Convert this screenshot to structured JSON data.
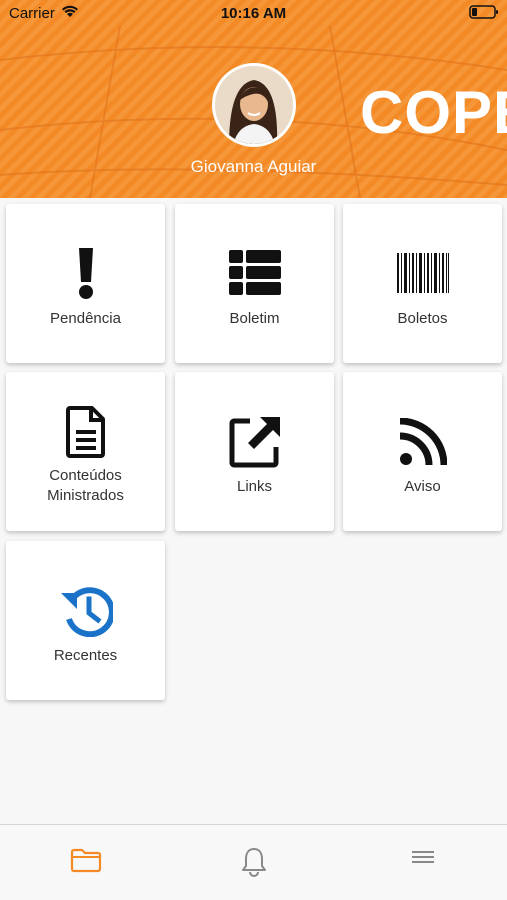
{
  "status_bar": {
    "carrier": "Carrier",
    "time": "10:16 AM"
  },
  "header": {
    "brand": "COPE",
    "user_name": "Giovanna Aguiar"
  },
  "tiles": [
    {
      "label": "Pendência",
      "icon": "exclamation-icon"
    },
    {
      "label": "Boletim",
      "icon": "table-list-icon"
    },
    {
      "label": "Boletos",
      "icon": "barcode-icon"
    },
    {
      "label": "Conteúdos Ministrados",
      "icon": "document-icon"
    },
    {
      "label": "Links",
      "icon": "external-link-icon"
    },
    {
      "label": "Aviso",
      "icon": "rss-icon"
    },
    {
      "label": "Recentes",
      "icon": "history-icon"
    }
  ],
  "tabbar": {
    "items": [
      {
        "icon": "folder-icon",
        "active": true
      },
      {
        "icon": "bell-icon",
        "active": false
      },
      {
        "icon": "menu-icon",
        "active": false
      }
    ]
  },
  "colors": {
    "accent": "#f38a26",
    "history_icon": "#1a73c8"
  }
}
